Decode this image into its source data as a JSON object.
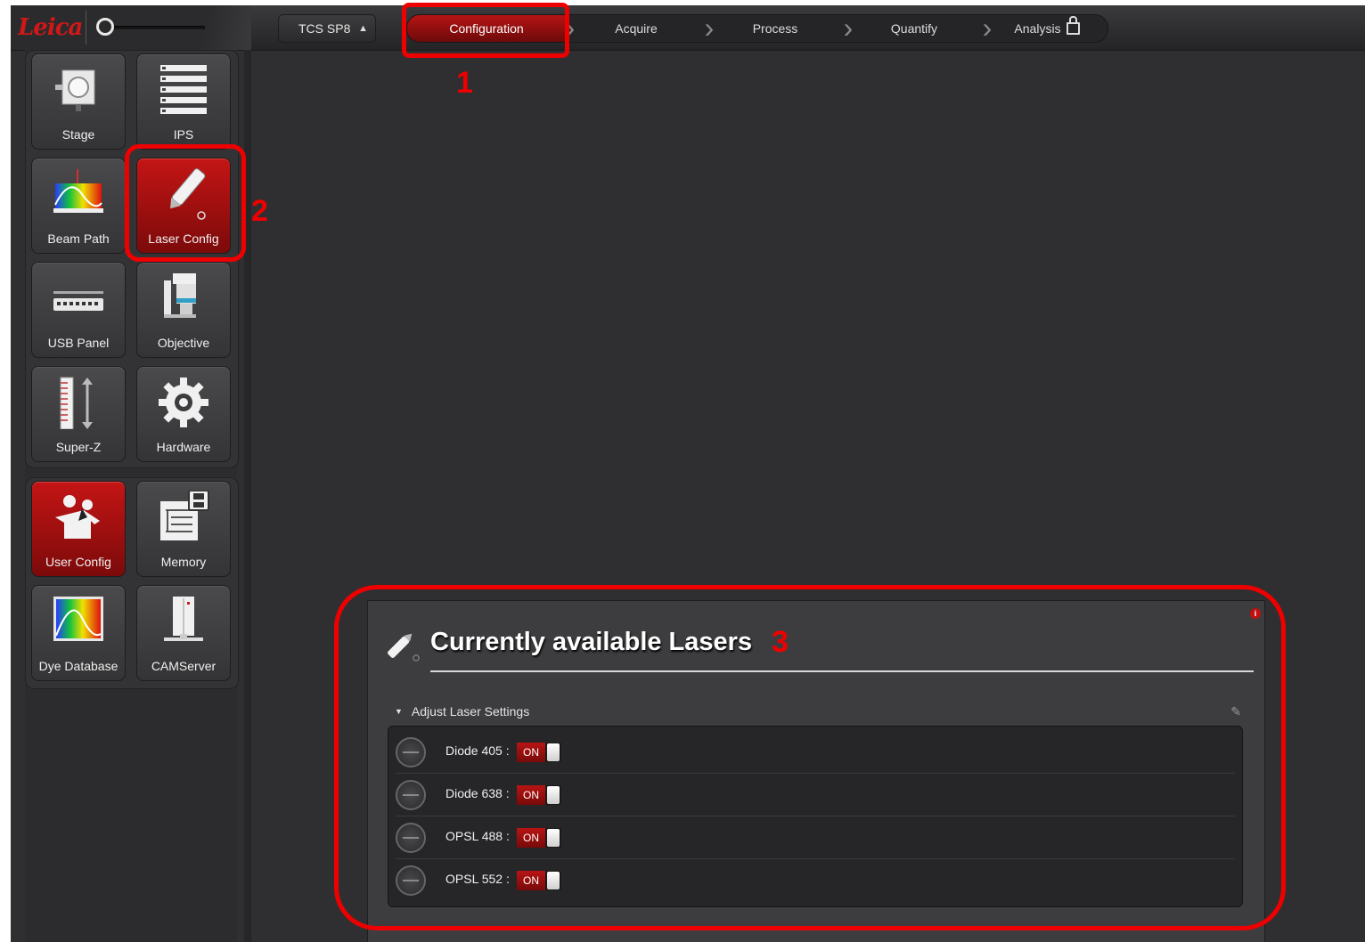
{
  "topbar": {
    "logo_text": "Leica",
    "system_select": {
      "value": "TCS SP8",
      "arrow_icon": "updown-arrows-icon"
    },
    "workflow_tabs": [
      {
        "label": "Configuration",
        "active": true
      },
      {
        "label": "Acquire",
        "active": false
      },
      {
        "label": "Process",
        "active": false
      },
      {
        "label": "Quantify",
        "active": false
      },
      {
        "label": "Analysis",
        "active": false,
        "icon": "lock-icon"
      }
    ]
  },
  "sidebar": {
    "config_tiles": [
      {
        "label": "Stage",
        "icon": "stage-icon"
      },
      {
        "label": "IPS",
        "icon": "ips-list-icon"
      },
      {
        "label": "Beam Path",
        "icon": "beam-path-spectrum-icon"
      },
      {
        "label": "Laser Config",
        "icon": "laser-pointer-icon",
        "active": true
      },
      {
        "label": "USB Panel",
        "icon": "usb-panel-icon"
      },
      {
        "label": "Objective",
        "icon": "objective-icon"
      },
      {
        "label": "Super-Z",
        "icon": "super-z-icon"
      },
      {
        "label": "Hardware",
        "icon": "gear-icon"
      }
    ],
    "user_tiles": [
      {
        "label": "User Config",
        "icon": "users-icon",
        "active": true
      },
      {
        "label": "Memory",
        "icon": "memory-save-icon"
      },
      {
        "label": "Dye Database",
        "icon": "dye-spectrum-icon"
      },
      {
        "label": "CAMServer",
        "icon": "server-icon"
      }
    ]
  },
  "laser_panel": {
    "title": "Currently available Lasers",
    "title_icon": "laser-pointer-icon",
    "info_icon": "info-icon",
    "section_label": "Adjust Laser Settings",
    "pin_icon": "pin-icon",
    "lasers": [
      {
        "name": "Diode 405 :",
        "state": "ON"
      },
      {
        "name": "Diode 638 :",
        "state": "ON"
      },
      {
        "name": "OPSL 488 :",
        "state": "ON"
      },
      {
        "name": "OPSL 552 :",
        "state": "ON"
      }
    ]
  },
  "annotations": {
    "one": "1",
    "two": "2",
    "three": "3"
  },
  "colors": {
    "accent_red": "#b51414",
    "annotation_red": "#ee0000",
    "background": "#2f2f31"
  }
}
